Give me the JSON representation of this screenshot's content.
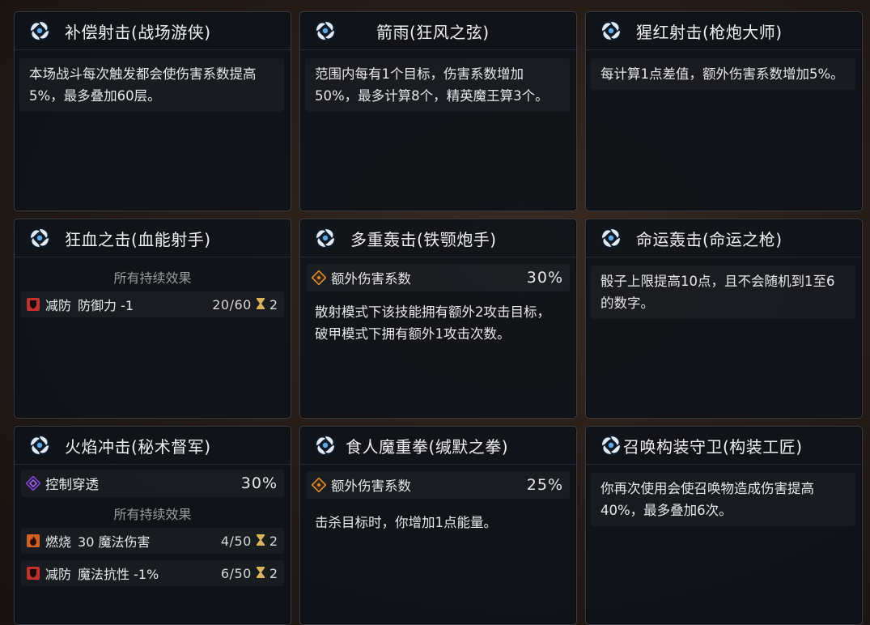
{
  "colors": {
    "accent_blue": "#5fa8e6",
    "debuff_red": "#c4302b",
    "burn_orange": "#d4621e",
    "control_purple": "#7a48d0",
    "damage_orange": "#d8902c",
    "hourglass_gold": "#d9b35a"
  },
  "cards": [
    {
      "icon": "vortex-skill-icon",
      "title": "补偿射击(战场游侠)",
      "desc": "本场战斗每次触发都会使伤害系数提高5%，最多叠加60层。"
    },
    {
      "icon": "vortex-skill-icon",
      "title": "箭雨(狂风之弦)",
      "desc": "范围内每有1个目标，伤害系数增加50%，最多计算8个，精英魔王算3个。"
    },
    {
      "icon": "vortex-skill-icon",
      "title": "猩红射击(枪炮大师)",
      "desc": "每计算1点差值，额外伤害系数增加5%。"
    },
    {
      "icon": "vortex-skill-icon",
      "title": "狂血之击(血能射手)",
      "section_label": "所有持续效果",
      "effects": [
        {
          "icon": "defense-down-icon",
          "name": "减防",
          "detail": "防御力 -1",
          "stacks": "20/60",
          "turns": "2"
        }
      ]
    },
    {
      "icon": "vortex-skill-icon",
      "title": "多重轰击(铁颚炮手)",
      "stat": {
        "icon": "extra-damage-icon",
        "label": "额外伤害系数",
        "value": "30%"
      },
      "desc": "散射模式下该技能拥有额外2攻击目标，破甲模式下拥有额外1攻击次数。"
    },
    {
      "icon": "vortex-skill-icon",
      "title": "命运轰击(命运之枪)",
      "desc": "骰子上限提高10点，且不会随机到1至6的数字。"
    },
    {
      "icon": "vortex-skill-icon",
      "title": "火焰冲击(秘术督军)",
      "stat": {
        "icon": "control-pierce-icon",
        "label": "控制穿透",
        "value": "30%"
      },
      "section_label": "所有持续效果",
      "effects": [
        {
          "icon": "burn-icon",
          "name": "燃烧",
          "detail": "30 魔法伤害",
          "stacks": "4/50",
          "turns": "2"
        },
        {
          "icon": "defense-down-icon",
          "name": "减防",
          "detail": "魔法抗性 -1%",
          "stacks": "6/50",
          "turns": "2"
        }
      ]
    },
    {
      "icon": "vortex-skill-icon",
      "title": "食人魔重拳(缄默之拳)",
      "stat": {
        "icon": "extra-damage-icon",
        "label": "额外伤害系数",
        "value": "25%"
      },
      "desc": "击杀目标时，你增加1点能量。"
    },
    {
      "icon": "vortex-skill-icon",
      "title": "召唤构装守卫(构装工匠)",
      "desc": "你再次使用会使召唤物造成伤害提高40%，最多叠加6次。"
    }
  ]
}
